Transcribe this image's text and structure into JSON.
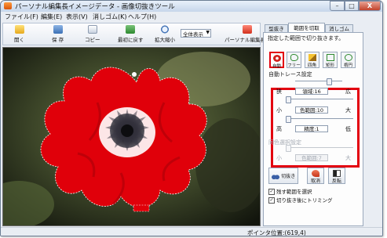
{
  "window": {
    "title": "パーソナル編集長イメージデータ - 画像切抜きツール",
    "min_glyph": "–",
    "max_glyph": "□",
    "close_glyph": "X"
  },
  "menu": {
    "items": [
      "ファイル(F)",
      "編集(E)",
      "表示(V)",
      "消しゴム(K)",
      "ヘルプ(H)"
    ]
  },
  "toolbar": {
    "open": "開く",
    "save": "保 存",
    "copy": "コピー",
    "reset": "最初に戻す",
    "zoom": "拡大縮小",
    "scale_value": "全体表示",
    "scale_arrow": "▼",
    "personal": "パーソナル編集長へ"
  },
  "tabs": [
    "型抜き",
    "範囲を切取",
    "消しゴム"
  ],
  "panel": {
    "instruction": "指定した範囲で切り抜きます。",
    "tools": [
      "自動",
      "フリー",
      "四角",
      "矩形",
      "楕円"
    ],
    "auto_trace": {
      "heading": "自動トレース設定",
      "smoothness": {
        "left": "狭",
        "right": "広",
        "value": "領域:16"
      },
      "color_range": {
        "left": "小",
        "right": "大",
        "value": "色範囲:10"
      },
      "precision": {
        "left": "高",
        "right": "低",
        "value": "精度:1"
      }
    },
    "same_color": {
      "heading": "同色選択設定",
      "color_range": {
        "left": "小",
        "right": "大",
        "value": "色範囲:7"
      }
    },
    "actions": {
      "cut": "切抜き",
      "undo": "取消",
      "invert": "反転"
    },
    "checkboxes": [
      {
        "label": "残す範囲を選択",
        "checked": true
      },
      {
        "label": "切り抜き後にトリミング",
        "checked": true
      }
    ]
  },
  "status": {
    "pointer": "ポインタ位置:(619,4)"
  },
  "colors": {
    "highlight": "#e3000f",
    "selection_fill": "#e0000a"
  }
}
